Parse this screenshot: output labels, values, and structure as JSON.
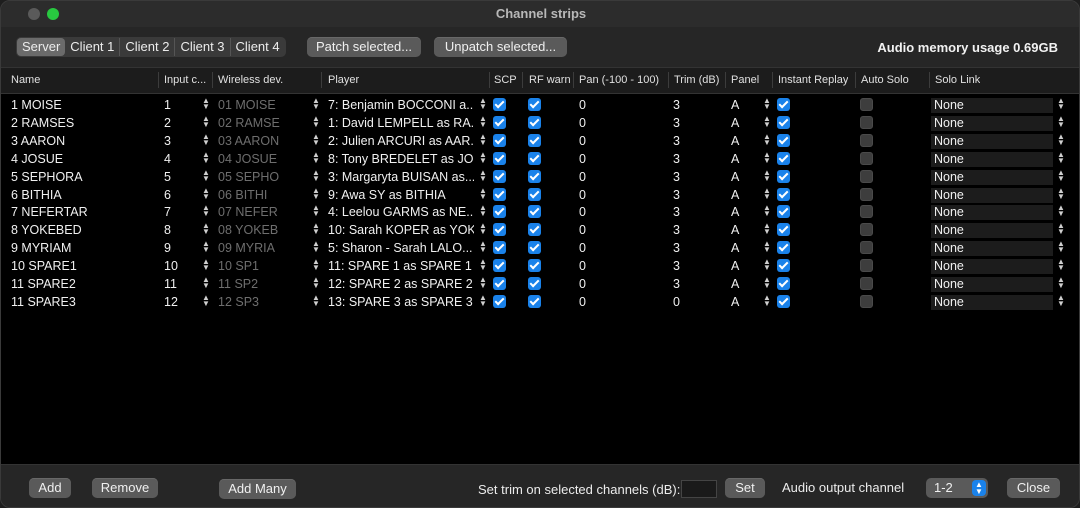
{
  "window": {
    "title": "Channel strips"
  },
  "toolbar": {
    "segments": [
      "Server",
      "Client 1",
      "Client 2",
      "Client 3",
      "Client 4"
    ],
    "patch_label": "Patch selected...",
    "unpatch_label": "Unpatch selected...",
    "memory_label": "Audio memory usage 0.69GB"
  },
  "table": {
    "columns": [
      "Name",
      "Input c...",
      "Wireless dev.",
      "Player",
      "SCP",
      "RF warn",
      "Pan (-100 - 100)",
      "Trim (dB)",
      "Panel",
      "Instant Replay",
      "Auto Solo",
      "Solo Link"
    ],
    "rows": [
      {
        "name": "1 MOISE",
        "input": "1",
        "wireless": "01 MOISE",
        "player": "7: Benjamin BOCCONI a...",
        "scp": true,
        "rf": true,
        "pan": "0",
        "trim": "3",
        "panel": "A",
        "replay": true,
        "autosolo": false,
        "solo": "None"
      },
      {
        "name": "2 RAMSES",
        "input": "2",
        "wireless": "02 RAMSE",
        "player": "1: David LEMPELL as RA...",
        "scp": true,
        "rf": true,
        "pan": "0",
        "trim": "3",
        "panel": "A",
        "replay": true,
        "autosolo": false,
        "solo": "None"
      },
      {
        "name": "3 AARON",
        "input": "3",
        "wireless": "03 AARON",
        "player": "2: Julien ARCURI as AAR...",
        "scp": true,
        "rf": true,
        "pan": "0",
        "trim": "3",
        "panel": "A",
        "replay": true,
        "autosolo": false,
        "solo": "None"
      },
      {
        "name": "4 JOSUE",
        "input": "4",
        "wireless": "04 JOSUE",
        "player": "8: Tony BREDELET as JO...",
        "scp": true,
        "rf": true,
        "pan": "0",
        "trim": "3",
        "panel": "A",
        "replay": true,
        "autosolo": false,
        "solo": "None"
      },
      {
        "name": "5 SEPHORA",
        "input": "5",
        "wireless": "05 SEPHO",
        "player": "3: Margaryta BUISAN as...",
        "scp": true,
        "rf": true,
        "pan": "0",
        "trim": "3",
        "panel": "A",
        "replay": true,
        "autosolo": false,
        "solo": "None"
      },
      {
        "name": "6 BITHIA",
        "input": "6",
        "wireless": "06 BITHI",
        "player": "9: Awa SY as BITHIA",
        "scp": true,
        "rf": true,
        "pan": "0",
        "trim": "3",
        "panel": "A",
        "replay": true,
        "autosolo": false,
        "solo": "None"
      },
      {
        "name": "7 NEFERTAR",
        "input": "7",
        "wireless": "07 NEFER",
        "player": "4: Leelou GARMS as NE...",
        "scp": true,
        "rf": true,
        "pan": "0",
        "trim": "3",
        "panel": "A",
        "replay": true,
        "autosolo": false,
        "solo": "None"
      },
      {
        "name": "8 YOKEBED",
        "input": "8",
        "wireless": "08 YOKEB",
        "player": "10: Sarah KOPER as YOK...",
        "scp": true,
        "rf": true,
        "pan": "0",
        "trim": "3",
        "panel": "A",
        "replay": true,
        "autosolo": false,
        "solo": "None"
      },
      {
        "name": "9 MYRIAM",
        "input": "9",
        "wireless": "09 MYRIA",
        "player": "5: Sharon - Sarah LALO...",
        "scp": true,
        "rf": true,
        "pan": "0",
        "trim": "3",
        "panel": "A",
        "replay": true,
        "autosolo": false,
        "solo": "None"
      },
      {
        "name": "10 SPARE1",
        "input": "10",
        "wireless": "10 SP1",
        "player": "11: SPARE 1 as SPARE 1",
        "scp": true,
        "rf": true,
        "pan": "0",
        "trim": "3",
        "panel": "A",
        "replay": true,
        "autosolo": false,
        "solo": "None"
      },
      {
        "name": "11 SPARE2",
        "input": "11",
        "wireless": "11 SP2",
        "player": "12: SPARE 2 as SPARE 2",
        "scp": true,
        "rf": true,
        "pan": "0",
        "trim": "3",
        "panel": "A",
        "replay": true,
        "autosolo": false,
        "solo": "None"
      },
      {
        "name": "11 SPARE3",
        "input": "12",
        "wireless": "12 SP3",
        "player": "13: SPARE 3 as SPARE 3",
        "scp": true,
        "rf": true,
        "pan": "0",
        "trim": "0",
        "panel": "A",
        "replay": true,
        "autosolo": false,
        "solo": "None"
      }
    ]
  },
  "bottom": {
    "add_label": "Add",
    "remove_label": "Remove",
    "add_many_label": "Add Many",
    "set_trim_label": "Set trim on selected channels (dB):",
    "set_label": "Set",
    "output_label": "Audio output channel",
    "output_value": "1-2",
    "close_label": "Close"
  },
  "colors": {
    "accent": "#1a82ea",
    "zoom_button": "#28c840"
  }
}
